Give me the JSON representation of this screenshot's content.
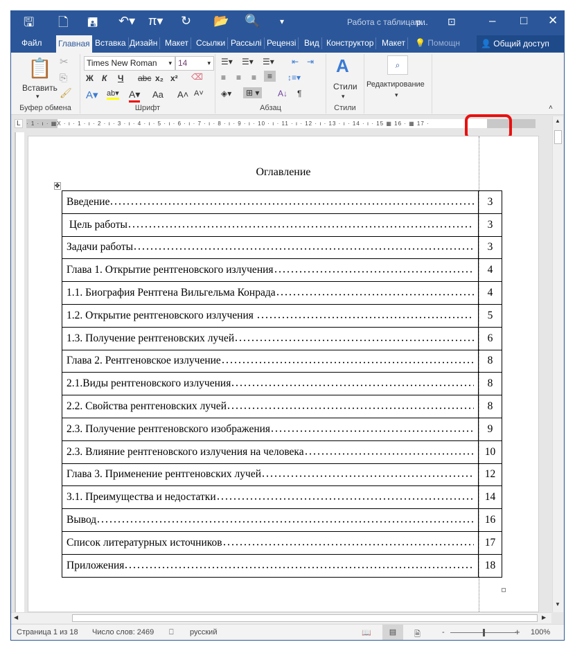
{
  "title_bar": {
    "context_tab": "Работа с таблицами",
    "doc_name": "р...",
    "quick_access": [
      "save-icon",
      "new-icon",
      "save-as-icon",
      "undo-icon",
      "pi-icon",
      "redo-icon",
      "open-icon",
      "print-preview-icon"
    ]
  },
  "tabs": [
    "Файл",
    "Главная",
    "Вставка",
    "Дизайн",
    "Макет",
    "Ссылки",
    "Рассылі",
    "Рецензі",
    "Вид",
    "Конструктор",
    "Макет"
  ],
  "help": "Помощн",
  "share": "Общий доступ",
  "ribbon": {
    "clipboard": {
      "paste": "Вставить",
      "label": "Буфер обмена"
    },
    "font": {
      "name": "Times New Roman",
      "size": "14",
      "bold": "Ж",
      "italic": "К",
      "underline": "Ч",
      "strike": "abc",
      "sub": "x₂",
      "sup": "x²",
      "case": "Aa",
      "grow": "A˄",
      "shrink": "A˅",
      "label": "Шрифт"
    },
    "paragraph": {
      "label": "Абзац",
      "pilcrow": "¶"
    },
    "styles": {
      "button": "Стили",
      "label": "Стили"
    },
    "editing": {
      "button": "Редактирование"
    }
  },
  "ruler": {
    "ticks": "· 1 · ı · ▦X · ı · 1 · ı · 2 · ı · 3 · ı · 4 · ı · 5 · ı · 6 · ı · 7 · ı · 8 · ı · 9 · ı · 10 · ı · 11 · ı · 12 · ı · 13 · ı · 14 · ı · 15 ▦ 16 · ▦ 17 ·"
  },
  "document": {
    "heading": "Оглавление",
    "toc": [
      {
        "title": "Введение",
        "page": "3"
      },
      {
        "title": " Цель работы",
        "page": "3"
      },
      {
        "title": "Задачи работы",
        "page": "3"
      },
      {
        "title": "Глава 1. Открытие рентгеновского излучения",
        "page": "4"
      },
      {
        "title": "1.1. Биография Рентгена Вильгельма Конрада",
        "page": "4"
      },
      {
        "title": "1.2. Открытие рентгеновского излучения ",
        "page": "5"
      },
      {
        "title": "1.3. Получение рентгеновских лучей",
        "page": "6"
      },
      {
        "title": "Глава 2. Рентгеновское излучение",
        "page": "8"
      },
      {
        "title": "2.1.Виды рентгеновского излучения",
        "page": "8"
      },
      {
        "title": "2.2. Свойства рентгеновских лучей",
        "page": "8"
      },
      {
        "title": "2.3. Получение рентгеновского изображения",
        "page": "9"
      },
      {
        "title": "2.3. Влияние рентгеновского излучения на человека",
        "page": "10"
      },
      {
        "title": "Глава 3. Применение рентгеновских лучей",
        "page": "12"
      },
      {
        "title": "3.1. Преимущества и недостатки",
        "page": "14"
      },
      {
        "title": "Вывод",
        "page": "16"
      },
      {
        "title": "Список литературных источников",
        "page": "17"
      },
      {
        "title": "Приложения",
        "page": "18"
      }
    ]
  },
  "status": {
    "page": "Страница 1 из 18",
    "words": "Число слов: 2469",
    "language": "русский",
    "zoom": "100%",
    "zoom_value": 100
  },
  "colors": {
    "brand": "#2b579a",
    "highlight": "#e81010"
  }
}
